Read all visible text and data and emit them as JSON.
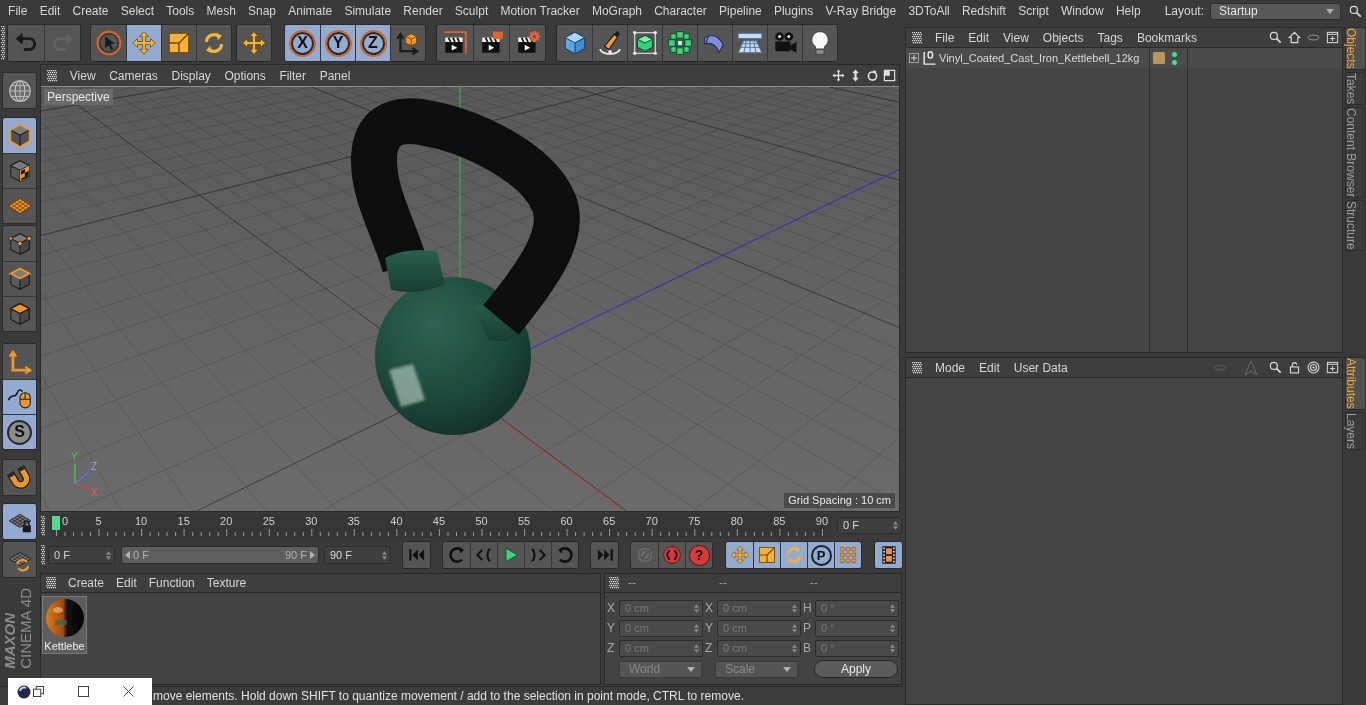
{
  "menu_bar": {
    "items": [
      "File",
      "Edit",
      "Create",
      "Select",
      "Tools",
      "Mesh",
      "Snap",
      "Animate",
      "Simulate",
      "Render",
      "Sculpt",
      "Motion Tracker",
      "MoGraph",
      "Character",
      "Pipeline",
      "Plugins",
      "V-Ray Bridge",
      "3DToAll",
      "Redshift",
      "Script",
      "Window",
      "Help"
    ],
    "layout_label": "Layout:",
    "layout_value": "Startup"
  },
  "toolbar": {
    "groups": [
      [
        {
          "kind": "undo",
          "on": false,
          "disabled": false
        },
        {
          "kind": "redo",
          "on": false,
          "disabled": true
        }
      ],
      [
        {
          "kind": "select",
          "on": false,
          "disabled": false
        },
        {
          "kind": "move",
          "on": true,
          "disabled": false
        },
        {
          "kind": "scale",
          "on": false,
          "disabled": false
        },
        {
          "kind": "rotate",
          "on": false,
          "disabled": false
        }
      ],
      [
        {
          "kind": "recent_tool",
          "on": false,
          "disabled": false
        }
      ],
      [
        {
          "kind": "axis_lock",
          "label": "X",
          "on": true,
          "disabled": false
        },
        {
          "kind": "axis_lock",
          "label": "Y",
          "on": true,
          "disabled": false
        },
        {
          "kind": "axis_lock",
          "label": "Z",
          "on": true,
          "disabled": false
        },
        {
          "kind": "coordinate_system",
          "on": false,
          "disabled": false
        }
      ],
      [
        {
          "kind": "render_view",
          "on": false,
          "disabled": false
        },
        {
          "kind": "render_picture",
          "on": false,
          "disabled": false
        },
        {
          "kind": "render_settings",
          "on": false,
          "disabled": false
        }
      ],
      [
        {
          "kind": "cube",
          "on": false,
          "disabled": false
        },
        {
          "kind": "pen",
          "on": false,
          "disabled": false
        },
        {
          "kind": "subdivision",
          "on": false,
          "disabled": false
        },
        {
          "kind": "cloner",
          "on": false,
          "disabled": false
        },
        {
          "kind": "deformer",
          "on": false,
          "disabled": false
        },
        {
          "kind": "floor",
          "on": false,
          "disabled": false
        },
        {
          "kind": "camera",
          "on": false,
          "disabled": false
        },
        {
          "kind": "light",
          "on": false,
          "disabled": false
        }
      ]
    ]
  },
  "left_toolbar": {
    "groups": [
      [
        {
          "kind": "make_editable",
          "on": false,
          "disabled": false
        }
      ],
      [
        {
          "kind": "model",
          "on": true,
          "disabled": false
        },
        {
          "kind": "texture",
          "on": false,
          "disabled": false
        },
        {
          "kind": "workplane",
          "on": false,
          "disabled": false
        }
      ],
      [
        {
          "kind": "points",
          "on": false,
          "disabled": false
        },
        {
          "kind": "edges",
          "on": false,
          "disabled": false
        },
        {
          "kind": "polygons",
          "on": false,
          "disabled": false
        }
      ],
      [
        {
          "kind": "axis",
          "on": false,
          "disabled": false
        },
        {
          "kind": "tweak",
          "on": true,
          "disabled": false
        },
        {
          "kind": "solo",
          "label": "S",
          "on": true,
          "disabled": false
        }
      ],
      [
        {
          "kind": "snap",
          "on": false,
          "disabled": false
        }
      ],
      [
        {
          "kind": "grid_lock",
          "on": true,
          "disabled": false
        }
      ],
      [
        {
          "kind": "grid_rotate",
          "on": false,
          "disabled": false
        }
      ]
    ]
  },
  "logo": {
    "brand": "MAXON",
    "product": "CINEMA 4D"
  },
  "viewport": {
    "menu": [
      "View",
      "Cameras",
      "Display",
      "Options",
      "Filter",
      "Panel"
    ],
    "camera": "Perspective",
    "grid_spacing": "Grid Spacing : 10 cm",
    "axis_labels": [
      "Y",
      "Z",
      "X"
    ]
  },
  "timeline": {
    "ticks": [
      "0",
      "5",
      "10",
      "15",
      "20",
      "25",
      "30",
      "35",
      "40",
      "45",
      "50",
      "55",
      "60",
      "65",
      "70",
      "75",
      "80",
      "85",
      "90"
    ],
    "playhead": {
      "level": 0
    },
    "current_frame": "0 F"
  },
  "transport": {
    "start_frame": "0 F",
    "range": {
      "start": "0 F",
      "end": "90 F",
      "level": 1
    },
    "end_frame": "90 F",
    "groups": [
      [
        {
          "kind": "go_start",
          "on": false,
          "disabled": false
        }
      ],
      [
        {
          "kind": "prev_key",
          "on": false,
          "disabled": false
        },
        {
          "kind": "prev_frame",
          "on": false,
          "disabled": false
        },
        {
          "kind": "play",
          "on": false,
          "disabled": false
        },
        {
          "kind": "next_frame",
          "on": false,
          "disabled": false
        },
        {
          "kind": "next_key",
          "on": false,
          "disabled": false
        }
      ],
      [
        {
          "kind": "go_end",
          "on": false,
          "disabled": false
        }
      ],
      [
        {
          "kind": "record_keys",
          "on": false,
          "disabled": true
        },
        {
          "kind": "autokey",
          "on": false,
          "disabled": false
        },
        {
          "kind": "key_selection",
          "label": "?",
          "on": false,
          "disabled": false
        }
      ],
      [
        {
          "kind": "key_position",
          "on": true,
          "disabled": false
        },
        {
          "kind": "key_scale",
          "on": true,
          "disabled": false
        },
        {
          "kind": "key_rotation",
          "on": true,
          "disabled": false
        },
        {
          "kind": "key_parameter",
          "label": "P",
          "on": true,
          "disabled": false
        },
        {
          "kind": "key_pla",
          "on": true,
          "disabled": false
        }
      ],
      [
        {
          "kind": "timeline_window",
          "on": true,
          "disabled": false
        }
      ]
    ]
  },
  "material_manager": {
    "menu": [
      "Create",
      "Edit",
      "Function",
      "Texture"
    ],
    "materials": [
      {
        "name": "Kettlebe"
      }
    ]
  },
  "coordinates": {
    "columns": [
      "--",
      "--",
      "--"
    ],
    "disabled": true,
    "rows": [
      [
        {
          "axis": "X",
          "value": "0 cm"
        },
        {
          "axis": "X",
          "value": "0 cm"
        },
        {
          "axis": "H",
          "value": "0 °"
        }
      ],
      [
        {
          "axis": "Y",
          "value": "0 cm"
        },
        {
          "axis": "Y",
          "value": "0 cm"
        },
        {
          "axis": "P",
          "value": "0 °"
        }
      ],
      [
        {
          "axis": "Z",
          "value": "0 cm"
        },
        {
          "axis": "Z",
          "value": "0 cm"
        },
        {
          "axis": "B",
          "value": "0 °"
        }
      ]
    ],
    "dropdowns": [
      "World",
      "Scale"
    ],
    "apply": "Apply"
  },
  "status_bar": {
    "text": "move elements. Hold down SHIFT to quantize movement / add to the selection in point mode, CTRL to remove."
  },
  "window_controls": [
    {
      "kind": "app"
    },
    {
      "kind": "restore"
    },
    {
      "kind": "maximize"
    },
    {
      "kind": "close"
    }
  ],
  "object_manager": {
    "menu": [
      "File",
      "Edit",
      "View",
      "Objects",
      "Tags",
      "Bookmarks"
    ],
    "objects": [
      {
        "name": "Vinyl_Coated_Cast_Iron_Kettlebell_12kg",
        "expanded": false,
        "editor_visible": true,
        "render_visible": true
      }
    ]
  },
  "side_tabs_top": [
    {
      "label": "Objects",
      "selected": true
    },
    {
      "label": "Takes",
      "selected": false
    },
    {
      "label": "Content Browser",
      "selected": false
    },
    {
      "label": "Structure",
      "selected": false
    }
  ],
  "attribute_manager": {
    "menu": [
      "Mode",
      "Edit",
      "User Data"
    ]
  },
  "side_tabs_bottom": [
    {
      "label": "Attributes",
      "selected": true
    },
    {
      "label": "Layers",
      "selected": false
    }
  ]
}
